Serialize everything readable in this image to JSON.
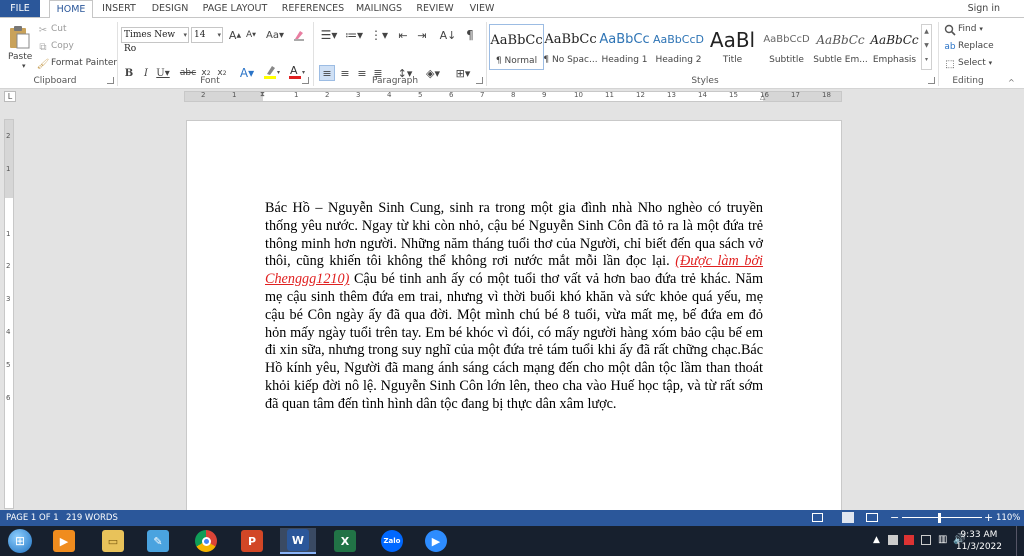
{
  "tabs": [
    "FILE",
    "HOME",
    "INSERT",
    "DESIGN",
    "PAGE LAYOUT",
    "REFERENCES",
    "MAILINGS",
    "REVIEW",
    "VIEW"
  ],
  "signin": "Sign in",
  "ribbon": {
    "clipboard": {
      "paste": "Paste",
      "cut": "Cut",
      "copy": "Copy",
      "format_painter": "Format Painter",
      "label": "Clipboard"
    },
    "font": {
      "name": "Times New Ro",
      "size": "14",
      "label": "Font",
      "font_color": "#e02020",
      "highlight_color": "#ffff00"
    },
    "paragraph": {
      "label": "Paragraph"
    },
    "styles": {
      "label": "Styles",
      "items": [
        {
          "sample": "AaBbCc",
          "name": "¶ Normal"
        },
        {
          "sample": "AaBbCc",
          "name": "¶ No Spac..."
        },
        {
          "sample": "AaBbCc",
          "name": "Heading 1"
        },
        {
          "sample": "AaBbCcD",
          "name": "Heading 2"
        },
        {
          "sample": "AaBl",
          "name": "Title"
        },
        {
          "sample": "AaBbCcD",
          "name": "Subtitle"
        },
        {
          "sample": "AaBbCc",
          "name": "Subtle Em..."
        },
        {
          "sample": "AaBbCc",
          "name": "Emphasis"
        }
      ]
    },
    "editing": {
      "find": "Find",
      "replace": "Replace",
      "select": "Select",
      "label": "Editing"
    }
  },
  "ruler": {
    "numbers": [
      "2",
      "1",
      "1",
      "2",
      "3",
      "4",
      "5",
      "6",
      "7",
      "8",
      "9",
      "10",
      "11",
      "12",
      "13",
      "14",
      "15",
      "16",
      "17",
      "18"
    ],
    "vnumbers": [
      "2",
      "1",
      "1",
      "2",
      "3",
      "4",
      "5",
      "6"
    ]
  },
  "document": {
    "text_before": "Bác Hồ – Nguyễn Sinh Cung, sinh ra trong một gia đình nhà Nho nghèo có truyền thống yêu nước. Ngay từ khi còn nhỏ, cậu bé Nguyễn Sinh Côn đã tỏ ra là một đứa trẻ thông minh hơn người. Những năm tháng tuổi thơ của Người, chỉ biết đến qua sách vở thôi, cũng khiến tôi không thể không rơi nước mắt mỗi lần đọc lại. ",
    "link_text": "(Được làm bởi Chenggg1210)",
    "text_after": " Cậu bé tinh anh ấy có một tuổi thơ vất vả hơn bao đứa trẻ khác. Năm mẹ cậu sinh thêm đứa em trai, nhưng vì thời buổi khó khăn và sức khỏe quá yếu, mẹ cậu bé Côn ngày ấy đã qua đời. Một mình chú bé 8 tuổi, vừa mất mẹ, bế đứa em đỏ hỏn mấy ngày tuổi trên tay. Em bé khóc vì đói, có mấy người hàng xóm bảo cậu bế em đi xin sữa, nhưng trong suy nghĩ của một đứa trẻ tám tuổi khi ấy đã rất chững chạc.Bác Hồ kính yêu, Người đã mang ánh sáng cách mạng đến cho một dân tộc lầm than thoát khỏi kiếp đời nô lệ. Nguyễn Sinh Côn lớn lên, theo cha vào Huế học tập, và từ rất sớm đã quan tâm đến tình hình dân tộc đang bị thực dân xâm lược."
  },
  "status": {
    "page": "PAGE 1 OF 1",
    "words": "219 WORDS",
    "zoom": "110%"
  },
  "taskbar": {
    "apps": [
      "start-icon",
      "media-player-icon",
      "file-explorer-icon",
      "paint-icon",
      "chrome-icon",
      "powerpoint-icon",
      "word-icon",
      "excel-icon",
      "zalo-icon",
      "zoom-icon"
    ],
    "zalo_label": "Zalo",
    "time": "9:33 AM",
    "date": "11/3/2022"
  }
}
